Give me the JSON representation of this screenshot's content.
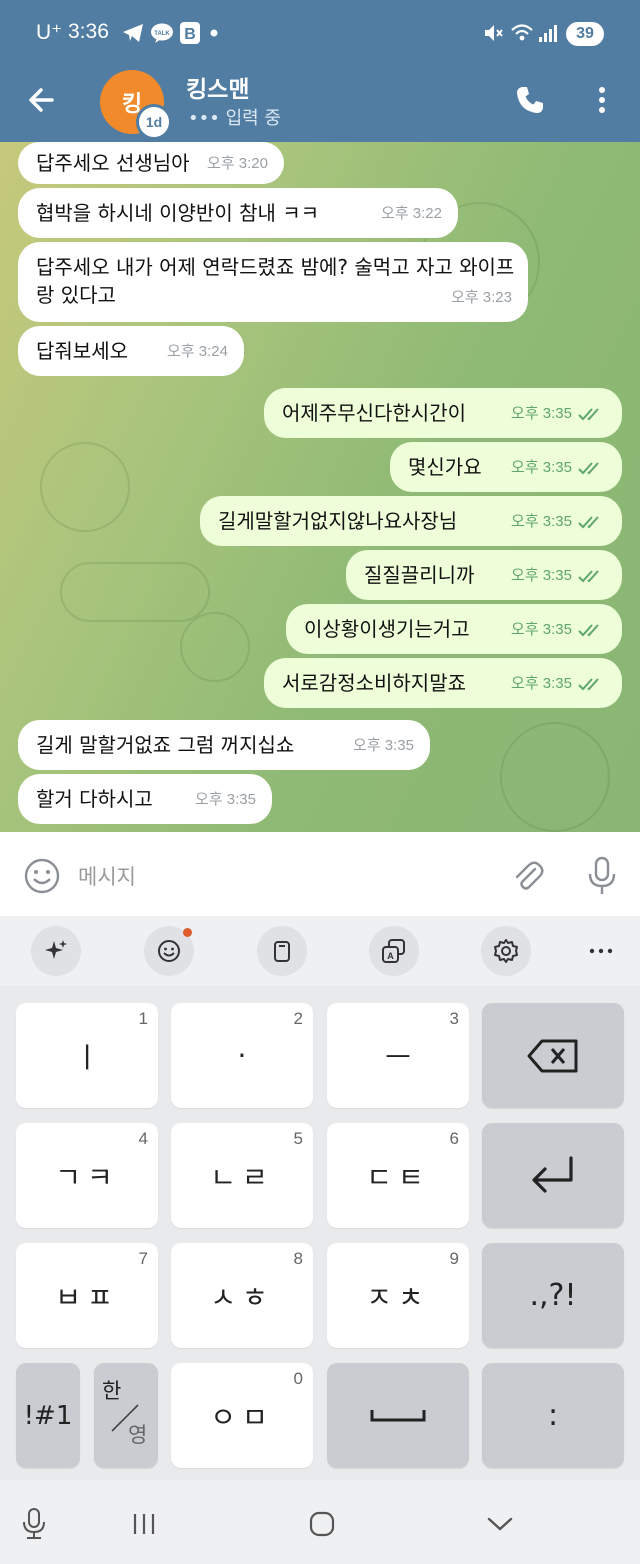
{
  "status_bar": {
    "carrier": "U⁺",
    "time": "3:36",
    "battery": "39",
    "icons": [
      "telegram-icon",
      "kakaotalk-icon",
      "b-app-icon",
      "dot-icon",
      "mute-icon",
      "wifi-icon",
      "signal-icon"
    ]
  },
  "header": {
    "avatar_letter": "킹",
    "avatar_badge": "1d",
    "name": "킹스맨",
    "status": "••• 입력 중",
    "avatar_color": "#f08a2a",
    "bar_color": "#517da2"
  },
  "messages": [
    {
      "dir": "in",
      "text": "답주세오 선생님아",
      "time": "오후 3:20"
    },
    {
      "dir": "in",
      "text": "협박을 하시네 이양반이 참내 ㅋㅋ",
      "time": "오후 3:22"
    },
    {
      "dir": "in",
      "text": "답주세오 내가 어제 연락드렸죠 밤에? 술먹고 자고 와이프랑 있다고",
      "time": "오후 3:23"
    },
    {
      "dir": "in",
      "text": "답줘보세오",
      "time": "오후 3:24"
    },
    {
      "dir": "out",
      "text": "어제주무신다한시간이",
      "time": "오후 3:35"
    },
    {
      "dir": "out",
      "text": "몇신가요",
      "time": "오후 3:35"
    },
    {
      "dir": "out",
      "text": "길게말할거없지않나요사장님",
      "time": "오후 3:35"
    },
    {
      "dir": "out",
      "text": "질질끌리니까",
      "time": "오후 3:35"
    },
    {
      "dir": "out",
      "text": "이상황이생기는거고",
      "time": "오후 3:35"
    },
    {
      "dir": "out",
      "text": "서로감정소비하지말죠",
      "time": "오후 3:35"
    },
    {
      "dir": "in",
      "text": "길게 말할거없죠 그럼 꺼지십쇼",
      "time": "오후 3:35"
    },
    {
      "dir": "in",
      "text": "할거 다하시고",
      "time": "오후 3:35"
    }
  ],
  "input": {
    "placeholder": "메시지"
  },
  "keyboard_toolbar": {
    "items": [
      "sparkle-ai-icon",
      "emoji-icon",
      "clipboard-icon",
      "translate-icon",
      "settings-icon",
      "more-icon"
    ]
  },
  "keyboard": {
    "row1": [
      {
        "label": "ㅣ",
        "num": "1"
      },
      {
        "label": "·",
        "num": "2"
      },
      {
        "label": "ㅡ",
        "num": "3"
      }
    ],
    "row2": [
      {
        "label": "ㄱㅋ",
        "num": "4"
      },
      {
        "label": "ㄴㄹ",
        "num": "5"
      },
      {
        "label": "ㄷㅌ",
        "num": "6"
      }
    ],
    "row3": [
      {
        "label": "ㅂㅍ",
        "num": "7"
      },
      {
        "label": "ㅅㅎ",
        "num": "8"
      },
      {
        "label": "ㅈㅊ",
        "num": "9"
      }
    ],
    "punct": ".,?!",
    "symbols": "!#1",
    "lang_top": "한",
    "lang_bottom": "영",
    "zero_key": {
      "label": "ㅇㅁ",
      "num": "0"
    },
    "colon": ":"
  }
}
